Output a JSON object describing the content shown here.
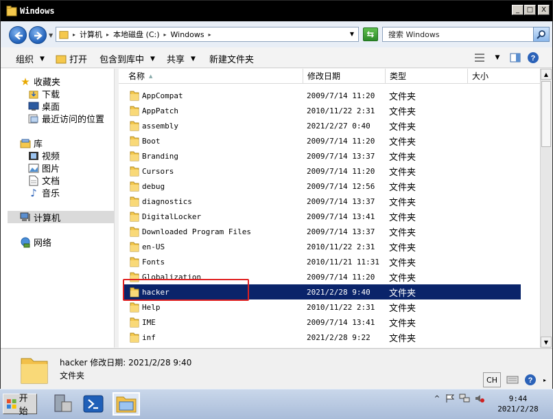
{
  "window": {
    "title": "Windows"
  },
  "title_buttons": {
    "minimize": "_",
    "maximize": "□",
    "close": "X"
  },
  "address": {
    "crumbs": [
      "计算机",
      "本地磁盘 (C:)",
      "Windows"
    ],
    "search_placeholder": "搜索 Windows"
  },
  "toolbar": {
    "organize": "组织",
    "open": "打开",
    "include_in_library": "包含到库中",
    "share": "共享",
    "new_folder": "新建文件夹"
  },
  "nav": {
    "favorites": "收藏夹",
    "downloads": "下载",
    "desktop": "桌面",
    "recent": "最近访问的位置",
    "libraries": "库",
    "videos": "视频",
    "pictures": "图片",
    "documents": "文档",
    "music": "音乐",
    "computer": "计算机",
    "network": "网络"
  },
  "columns": {
    "name": "名称",
    "date": "修改日期",
    "type": "类型",
    "size": "大小"
  },
  "files": [
    {
      "name": "AppCompat",
      "date": "2009/7/14 11:20",
      "type": "文件夹"
    },
    {
      "name": "AppPatch",
      "date": "2010/11/22 2:31",
      "type": "文件夹"
    },
    {
      "name": "assembly",
      "date": "2021/2/27 0:40",
      "type": "文件夹"
    },
    {
      "name": "Boot",
      "date": "2009/7/14 11:20",
      "type": "文件夹"
    },
    {
      "name": "Branding",
      "date": "2009/7/14 13:37",
      "type": "文件夹"
    },
    {
      "name": "Cursors",
      "date": "2009/7/14 11:20",
      "type": "文件夹"
    },
    {
      "name": "debug",
      "date": "2009/7/14 12:56",
      "type": "文件夹"
    },
    {
      "name": "diagnostics",
      "date": "2009/7/14 13:37",
      "type": "文件夹"
    },
    {
      "name": "DigitalLocker",
      "date": "2009/7/14 13:41",
      "type": "文件夹"
    },
    {
      "name": "Downloaded Program Files",
      "date": "2009/7/14 13:37",
      "type": "文件夹"
    },
    {
      "name": "en-US",
      "date": "2010/11/22 2:31",
      "type": "文件夹"
    },
    {
      "name": "Fonts",
      "date": "2010/11/21 11:31",
      "type": "文件夹"
    },
    {
      "name": "Globalization",
      "date": "2009/7/14 11:20",
      "type": "文件夹"
    },
    {
      "name": "hacker",
      "date": "2021/2/28 9:40",
      "type": "文件夹"
    },
    {
      "name": "Help",
      "date": "2010/11/22 2:31",
      "type": "文件夹"
    },
    {
      "name": "IME",
      "date": "2009/7/14 13:41",
      "type": "文件夹"
    },
    {
      "name": "inf",
      "date": "2021/2/28 9:22",
      "type": "文件夹"
    }
  ],
  "selected_index": 13,
  "details": {
    "name_line": "hacker 修改日期: 2021/2/28 9:40",
    "type": "文件夹"
  },
  "langbar": {
    "lang": "CH"
  },
  "taskbar": {
    "start": "开始",
    "time": "9:44",
    "date": "2021/2/28"
  },
  "colors": {
    "selection": "#0a246a",
    "highlight_border": "#e02020",
    "folder": "#f5c84c"
  }
}
